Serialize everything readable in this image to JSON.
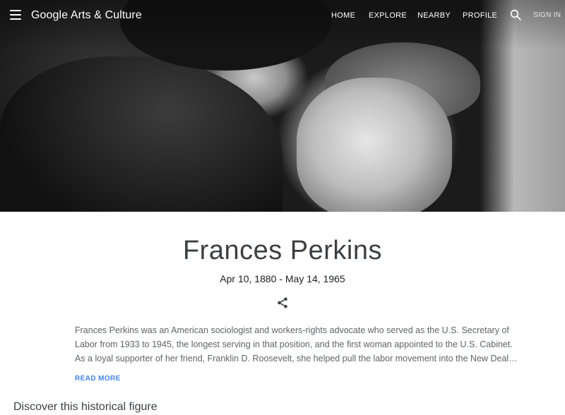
{
  "header": {
    "brand": "Google Arts & Culture",
    "nav": [
      {
        "label": "HOME"
      },
      {
        "label": "EXPLORE"
      },
      {
        "label": "NEARBY"
      },
      {
        "label": "PROFILE"
      }
    ],
    "sign_in": "SIGN IN"
  },
  "hero": {
    "image": "black-and-white photograph of a woman in a hat leaning toward a laughing man"
  },
  "figure": {
    "name": "Frances Perkins",
    "dates": "Apr 10, 1880 - May 14, 1965",
    "description_lines": [
      "Frances Perkins was an American sociologist and workers-rights advocate who served as the U.S. Secretary of",
      "Labor from 1933 to 1945, the longest serving in that position, and the first woman appointed to the U.S. Cabinet.",
      "As a loyal supporter of her friend, Franklin D. Roosevelt, she helped pull the labor movement into the New Deal…"
    ],
    "read_more": "READ MORE"
  },
  "sections": {
    "discover_title": "Discover this historical figure"
  },
  "icons": {
    "menu": "menu-icon",
    "search": "search-icon",
    "share": "share-icon"
  },
  "colors": {
    "accent": "#4285f4",
    "title_text": "#3c4043",
    "body_text": "#5f6368"
  }
}
